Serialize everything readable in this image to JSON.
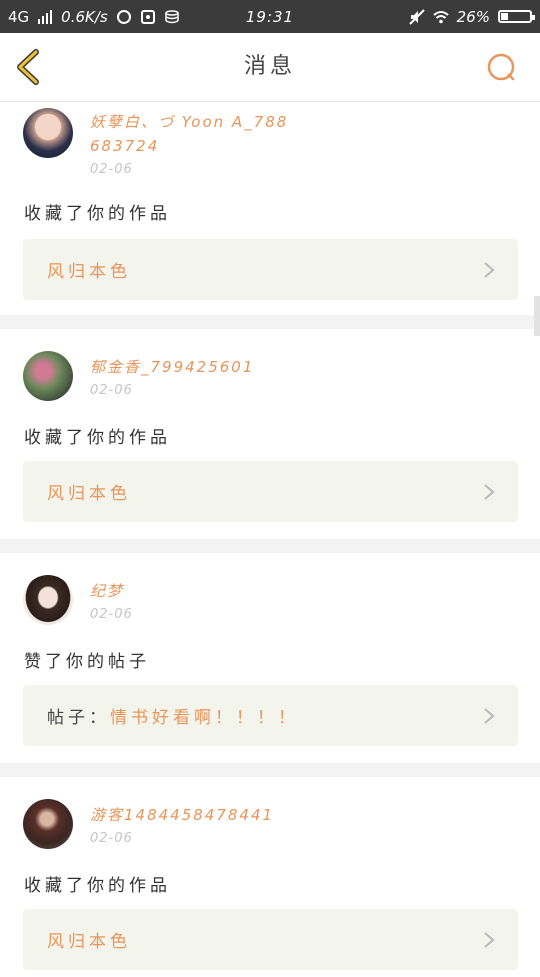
{
  "status_bar": {
    "network": "4G",
    "speed": "0.6K/s",
    "time": "19:31",
    "battery": "26%",
    "battery_level": 0.26
  },
  "nav": {
    "title": "消息"
  },
  "messages": [
    {
      "user": "妖孽白、づ Yoon A_788683724",
      "date": "02-06",
      "action": "收藏了你的作品",
      "prefix": "",
      "work": "风归本色"
    },
    {
      "user": "郁金香_799425601",
      "date": "02-06",
      "action": "收藏了你的作品",
      "prefix": "",
      "work": "风归本色"
    },
    {
      "user": "纪梦",
      "date": "02-06",
      "action": "赞了你的帖子",
      "prefix": "帖子：",
      "work": "情书好看啊！！！！"
    },
    {
      "user": "游客1484458478441",
      "date": "02-06",
      "action": "收藏了你的作品",
      "prefix": "",
      "work": "风归本色"
    }
  ],
  "icons": {
    "back": "chevron-left-icon",
    "search": "search-icon",
    "chevron": "chevron-right-icon"
  },
  "colors": {
    "accent": "#e8955a",
    "back_arrow": "#f0c030",
    "card_bg": "#f3f4ec",
    "status_bar": "#3b3b3b"
  }
}
